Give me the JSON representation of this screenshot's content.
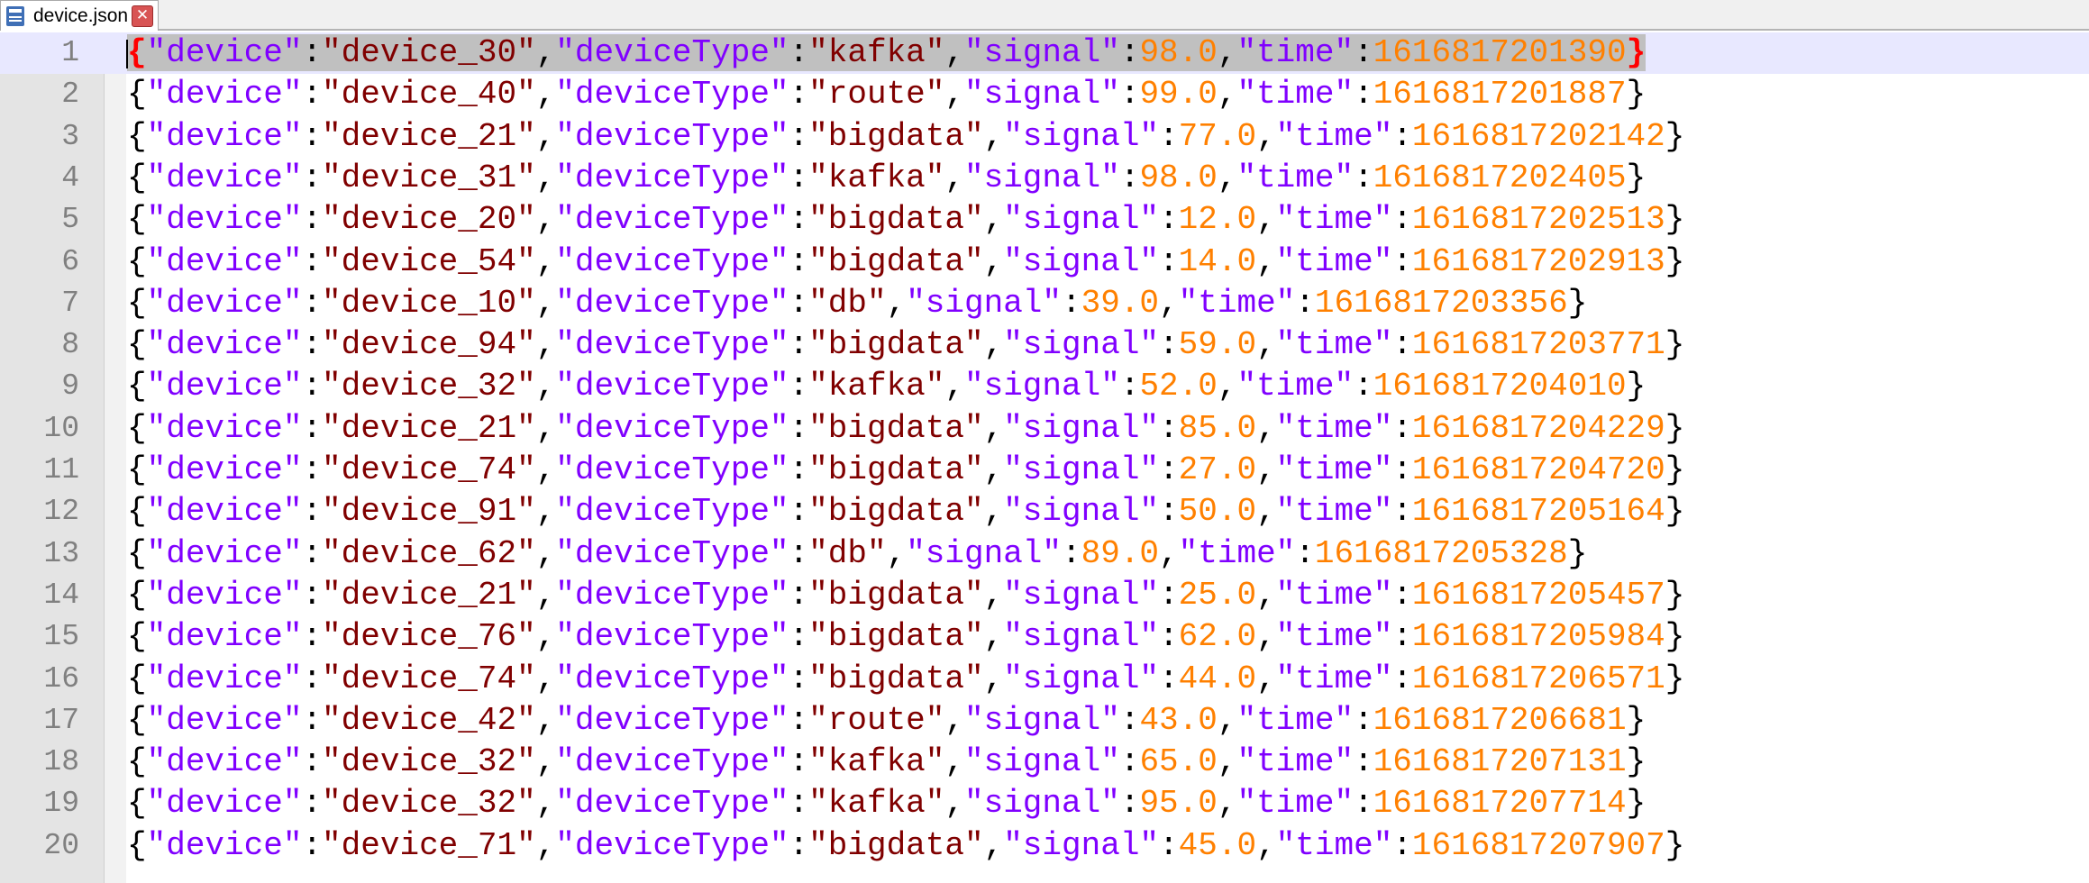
{
  "tab": {
    "filename": "device.json",
    "close_symbol": "✕",
    "icon": "file-icon"
  },
  "editor": {
    "current_line": 1,
    "lines": [
      {
        "n": "1",
        "device": "device_30",
        "deviceType": "kafka",
        "signal": "98.0",
        "time": "1616817201390"
      },
      {
        "n": "2",
        "device": "device_40",
        "deviceType": "route",
        "signal": "99.0",
        "time": "1616817201887"
      },
      {
        "n": "3",
        "device": "device_21",
        "deviceType": "bigdata",
        "signal": "77.0",
        "time": "1616817202142"
      },
      {
        "n": "4",
        "device": "device_31",
        "deviceType": "kafka",
        "signal": "98.0",
        "time": "1616817202405"
      },
      {
        "n": "5",
        "device": "device_20",
        "deviceType": "bigdata",
        "signal": "12.0",
        "time": "1616817202513"
      },
      {
        "n": "6",
        "device": "device_54",
        "deviceType": "bigdata",
        "signal": "14.0",
        "time": "1616817202913"
      },
      {
        "n": "7",
        "device": "device_10",
        "deviceType": "db",
        "signal": "39.0",
        "time": "1616817203356"
      },
      {
        "n": "8",
        "device": "device_94",
        "deviceType": "bigdata",
        "signal": "59.0",
        "time": "1616817203771"
      },
      {
        "n": "9",
        "device": "device_32",
        "deviceType": "kafka",
        "signal": "52.0",
        "time": "1616817204010"
      },
      {
        "n": "10",
        "device": "device_21",
        "deviceType": "bigdata",
        "signal": "85.0",
        "time": "1616817204229"
      },
      {
        "n": "11",
        "device": "device_74",
        "deviceType": "bigdata",
        "signal": "27.0",
        "time": "1616817204720"
      },
      {
        "n": "12",
        "device": "device_91",
        "deviceType": "bigdata",
        "signal": "50.0",
        "time": "1616817205164"
      },
      {
        "n": "13",
        "device": "device_62",
        "deviceType": "db",
        "signal": "89.0",
        "time": "1616817205328"
      },
      {
        "n": "14",
        "device": "device_21",
        "deviceType": "bigdata",
        "signal": "25.0",
        "time": "1616817205457"
      },
      {
        "n": "15",
        "device": "device_76",
        "deviceType": "bigdata",
        "signal": "62.0",
        "time": "1616817205984"
      },
      {
        "n": "16",
        "device": "device_74",
        "deviceType": "bigdata",
        "signal": "44.0",
        "time": "1616817206571"
      },
      {
        "n": "17",
        "device": "device_42",
        "deviceType": "route",
        "signal": "43.0",
        "time": "1616817206681"
      },
      {
        "n": "18",
        "device": "device_32",
        "deviceType": "kafka",
        "signal": "65.0",
        "time": "1616817207131"
      },
      {
        "n": "19",
        "device": "device_32",
        "deviceType": "kafka",
        "signal": "95.0",
        "time": "1616817207714"
      },
      {
        "n": "20",
        "device": "device_71",
        "deviceType": "bigdata",
        "signal": "45.0",
        "time": "1616817207907"
      }
    ]
  },
  "colors": {
    "key": "#8000ff",
    "string": "#800000",
    "number": "#ff8000",
    "brace_match": "#ff0000"
  }
}
